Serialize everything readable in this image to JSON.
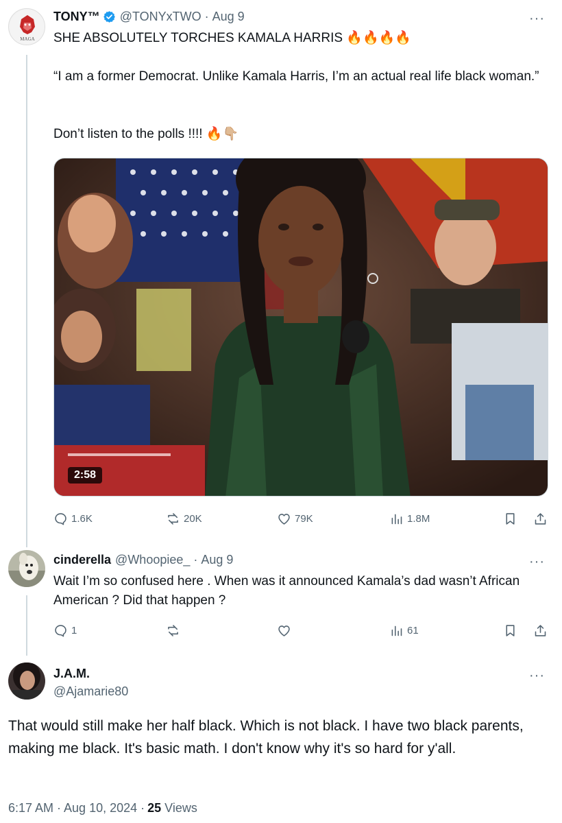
{
  "post1": {
    "name": "TONY™",
    "handle": "@TONYxTWO",
    "separator": "·",
    "time": "Aug 9",
    "avatar_text": "MAGA",
    "line1": "SHE ABSOLUTELY TORCHES KAMALA HARRIS 🔥🔥🔥🔥",
    "line2": "“I am a former Democrat. Unlike Kamala Harris, I’m an actual real life black woman.”",
    "line3": "Don’t listen to the polls !!!! 🔥👇🏼",
    "video_duration": "2:58",
    "replies": "1.6K",
    "reposts": "20K",
    "likes": "79K",
    "views": "1.8M"
  },
  "post2": {
    "name": "cinderella",
    "handle": "@Whoopiee_",
    "separator": "·",
    "time": "Aug 9",
    "text": "Wait I’m so confused here . When was it announced Kamala’s dad wasn’t African American ? Did that happen ?",
    "replies": "1",
    "reposts": "",
    "likes": "",
    "views": "61"
  },
  "post3": {
    "name": "J.A.M.",
    "handle": "@Ajamarie80",
    "text": "That would still make her half black. Which is not black. I have two black parents, making me black. It's basic math. I don't know why it's so hard for y'all.",
    "timestamp": "6:17 AM · Aug 10, 2024 · ",
    "views_count": "25",
    "views_label": " Views"
  },
  "more_label": "···",
  "colors": {
    "accent": "#1d9bf0",
    "secondary": "#536471",
    "line": "#cfd9de"
  },
  "icons": [
    "reply-icon",
    "repost-icon",
    "like-icon",
    "views-icon",
    "bookmark-icon",
    "share-icon",
    "verified-badge-icon",
    "more-icon"
  ]
}
